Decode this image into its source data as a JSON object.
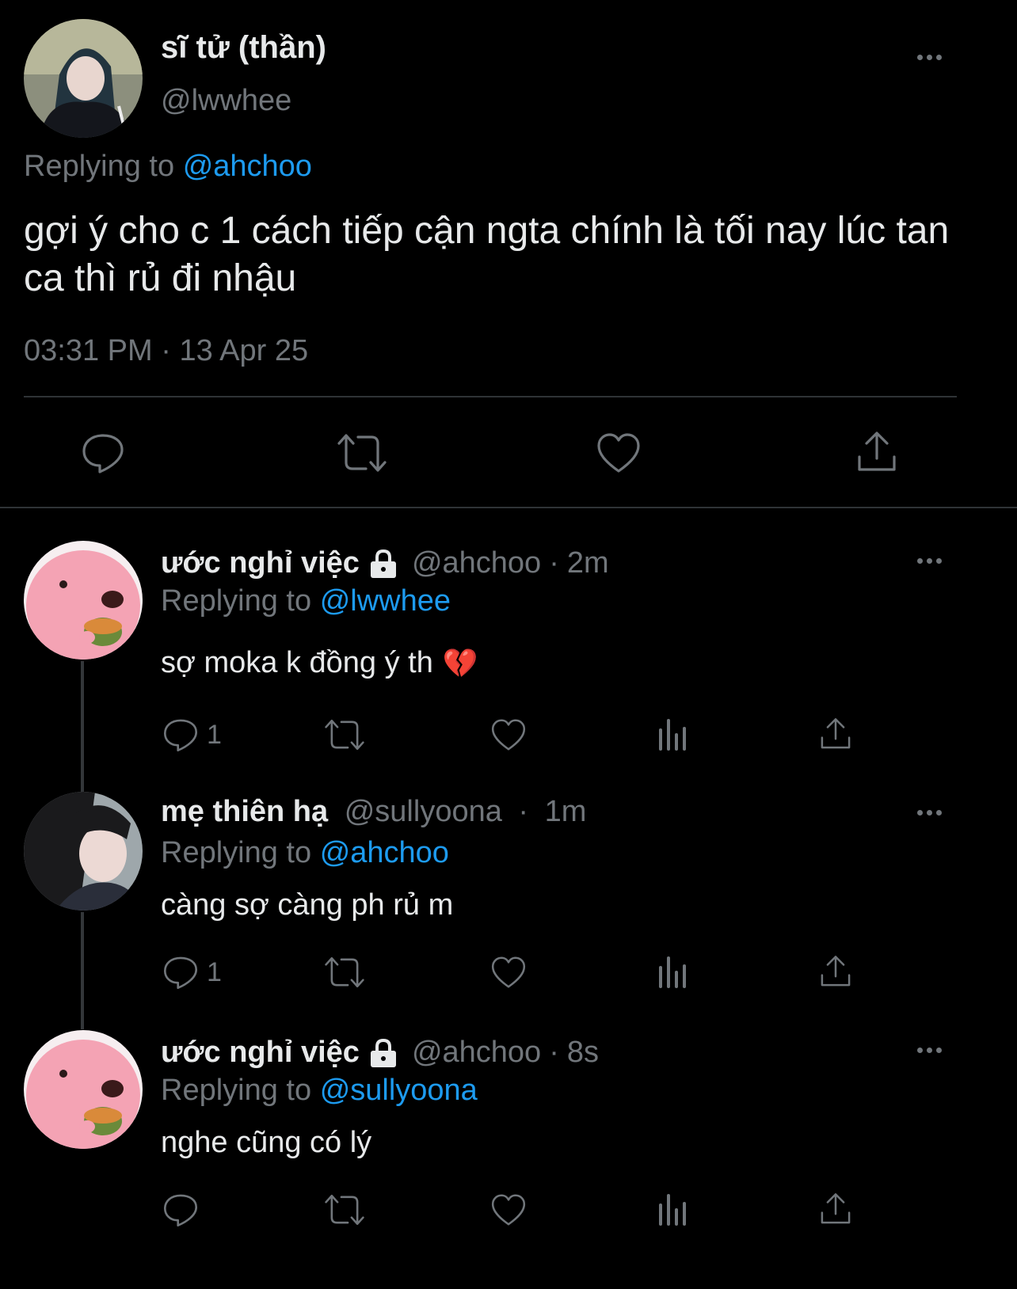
{
  "main_tweet": {
    "display_name": "sĩ tử (thần)",
    "handle": "@lwwhee",
    "replying_prefix": "Replying to",
    "replying_to": "@ahchoo",
    "text": "gợi ý cho c 1 cách tiếp cận ngta chính là tối nay lúc tan ca thì rủ đi nhậu",
    "time": "03:31 PM",
    "separator": "·",
    "date": "13 Apr 25"
  },
  "replies": [
    {
      "display_name": "ước nghỉ việc",
      "locked": true,
      "handle": "@ahchoo",
      "separator": "·",
      "time": "2m",
      "replying_prefix": "Replying to",
      "replying_to": "@lwwhee",
      "text": "sợ moka k đồng ý th",
      "emoji": "💔",
      "reply_count": "1"
    },
    {
      "display_name": "mẹ thiên hạ",
      "locked": false,
      "handle": "@sullyoona",
      "separator": "·",
      "time": "1m",
      "replying_prefix": "Replying to",
      "replying_to": "@ahchoo",
      "text": "càng sợ càng ph rủ m",
      "reply_count": "1"
    },
    {
      "display_name": "ước nghỉ việc",
      "locked": true,
      "handle": "@ahchoo",
      "separator": "·",
      "time": "8s",
      "replying_prefix": "Replying to",
      "replying_to": "@sullyoona",
      "text": "nghe cũng có lý",
      "reply_count": ""
    }
  ],
  "colors": {
    "background": "#000000",
    "text": "#e7e9ea",
    "secondary": "#71767b",
    "link": "#1d9bf0",
    "divider": "#2f3336",
    "avatar_pink": "#f4a3b4"
  },
  "icons": [
    "more-icon",
    "reply-icon",
    "retweet-icon",
    "like-icon",
    "views-icon",
    "share-icon",
    "lock-icon"
  ]
}
